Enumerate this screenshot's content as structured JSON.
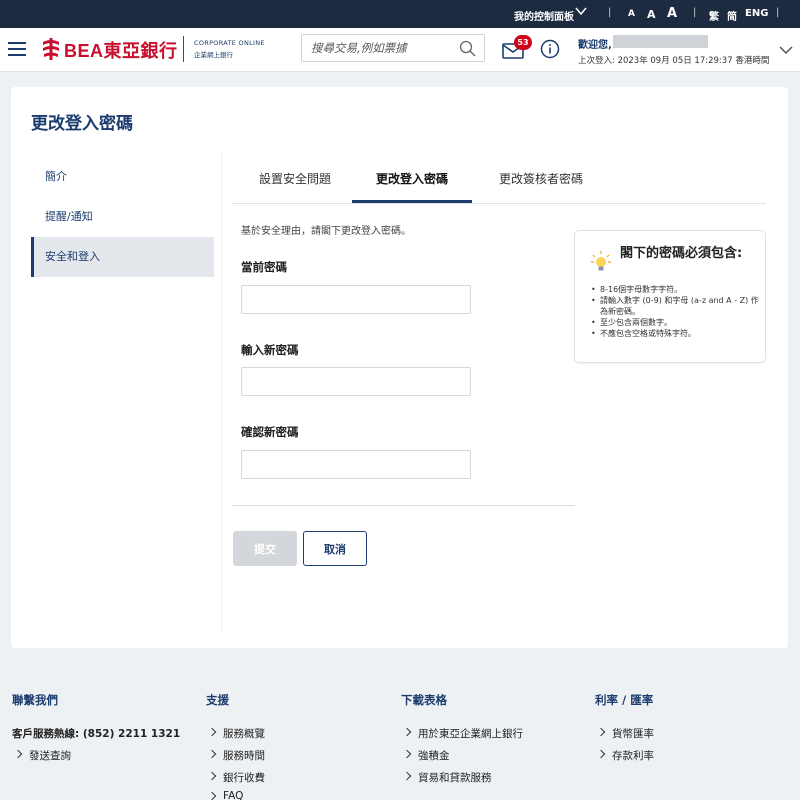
{
  "topbar": {
    "dashboard": "我的控制面板",
    "font_sizes": [
      "A",
      "A",
      "A"
    ],
    "lang_trad": "繁",
    "lang_simp": "简",
    "lang_eng": "ENG"
  },
  "header": {
    "logo_text": "BEA東亞銀行",
    "corporate_line1": "CORPORATE ONLINE",
    "corporate_line2": "企業網上銀行",
    "search_placeholder": "搜尋交易,例如票據",
    "mail_badge": "53",
    "welcome": "歡迎您,",
    "last_login": "上次登入: 2023年 09月 05日 17:29:37 香港時間"
  },
  "page": {
    "title": "更改登入密碼",
    "sidebar": [
      {
        "label": "簡介",
        "active": false
      },
      {
        "label": "提醒/通知",
        "active": false
      },
      {
        "label": "安全和登入",
        "active": true
      }
    ],
    "tabs": [
      {
        "label": "設置安全問題",
        "active": false
      },
      {
        "label": "更改登入密碼",
        "active": true
      },
      {
        "label": "更改簽核者密碼",
        "active": false
      }
    ],
    "intro": "基於安全理由，請閣下更改登入密碼。",
    "fields": [
      {
        "label": "當前密碼",
        "value": ""
      },
      {
        "label": "輸入新密碼",
        "value": ""
      },
      {
        "label": "確認新密碼",
        "value": ""
      }
    ],
    "submit_label": "提交",
    "cancel_label": "取消",
    "tips": {
      "title": "閣下的密碼必須包含:",
      "items": [
        "8-16個字母數字字符。",
        "請輸入數字 (0-9) 和字母 (a-z and A - Z) 作為新密碼。",
        "至少包含兩個數字。",
        "不應包含空格或特殊字符。"
      ]
    }
  },
  "footer": {
    "contact": {
      "heading": "聯繫我們",
      "hotline": "客戶服務熱線: (852) 2211 1321",
      "links": [
        "發送查詢"
      ]
    },
    "support": {
      "heading": "支援",
      "links": [
        "服務概覽",
        "服務時間",
        "銀行收費",
        "FAQ"
      ]
    },
    "downloads": {
      "heading": "下載表格",
      "links": [
        "用於東亞企業網上銀行",
        "強積金",
        "貿易和貸款服務"
      ]
    },
    "rates": {
      "heading": "利率 / 匯率",
      "links": [
        "貨幣匯率",
        "存款利率"
      ]
    }
  },
  "colors": {
    "navy": "#1c3d6e",
    "brand_red": "#c8102e",
    "topbar": "#1c2b40",
    "badge_red": "#d0021b"
  }
}
